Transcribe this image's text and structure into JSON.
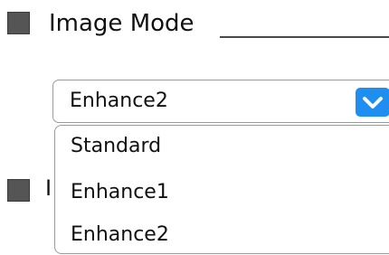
{
  "section": {
    "title": "Image Mode"
  },
  "select": {
    "value": "Enhance2",
    "arrow_icon": "chevron-down-icon",
    "accent_color": "#1f8ef1",
    "options": [
      "Standard",
      "Enhance1",
      "Enhance2"
    ]
  },
  "hidden_label": {
    "partial": "I"
  }
}
